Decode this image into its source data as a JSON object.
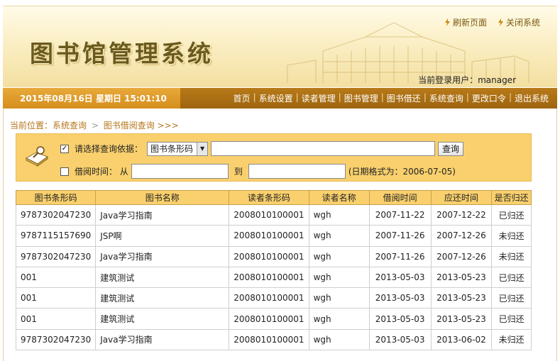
{
  "header": {
    "title": "图书馆管理系统",
    "refresh_label": "刷新页面",
    "close_label": "关闭系统",
    "login_text": "当前登录用户：manager"
  },
  "navbar": {
    "datetime": "2015年08月16日 星期日 15:01:10",
    "menu": [
      "首页",
      "系统设置",
      "读者管理",
      "图书管理",
      "图书借还",
      "系统查询",
      "更改口令",
      "退出系统"
    ]
  },
  "breadcrumb": {
    "prefix": "当前位置：系统查询",
    "sep": ">",
    "current": "图书借阅查询 >>>"
  },
  "query": {
    "basis_label": "请选择查询依据：",
    "basis_selected": "图书条形码",
    "search_value": "",
    "search_button": "查询",
    "date_label": "借阅时间： 从",
    "date_to": "到",
    "date_from_value": "",
    "date_to_value": "",
    "date_hint": "(日期格式为：2006-07-05)"
  },
  "table": {
    "columns": [
      "图书条形码",
      "图书名称",
      "读者条形码",
      "读者名称",
      "借阅时间",
      "应还时间",
      "是否归还"
    ],
    "rows": [
      [
        "9787302047230",
        "Java学习指南",
        "2008010100001",
        "wgh",
        "2007-11-22",
        "2007-12-22",
        "已归还"
      ],
      [
        "9787115157690",
        "JSP啊",
        "2008010100001",
        "wgh",
        "2007-11-26",
        "2007-12-26",
        "未归还"
      ],
      [
        "9787302047230",
        "Java学习指南",
        "2008010100001",
        "wgh",
        "2007-11-26",
        "2007-12-26",
        "未归还"
      ],
      [
        "001",
        "建筑测试",
        "2008010100001",
        "wgh",
        "2013-05-03",
        "2013-05-23",
        "已归还"
      ],
      [
        "001",
        "建筑测试",
        "2008010100001",
        "wgh",
        "2013-05-03",
        "2013-05-23",
        "已归还"
      ],
      [
        "001",
        "建筑测试",
        "2008010100001",
        "wgh",
        "2013-05-03",
        "2013-05-23",
        "已归还"
      ],
      [
        "9787302047230",
        "Java学习指南",
        "2008010100001",
        "wgh",
        "2013-05-03",
        "2013-06-02",
        "未归还"
      ]
    ]
  },
  "colors": {
    "nav_bar": "#a86c12",
    "date_box": "#e09a28",
    "query_bg": "#f9d06d",
    "breadcrumb": "#b5761a"
  },
  "icons": {
    "refresh": "lightning-icon",
    "close": "lightning-icon",
    "query": "book-search-icon"
  }
}
